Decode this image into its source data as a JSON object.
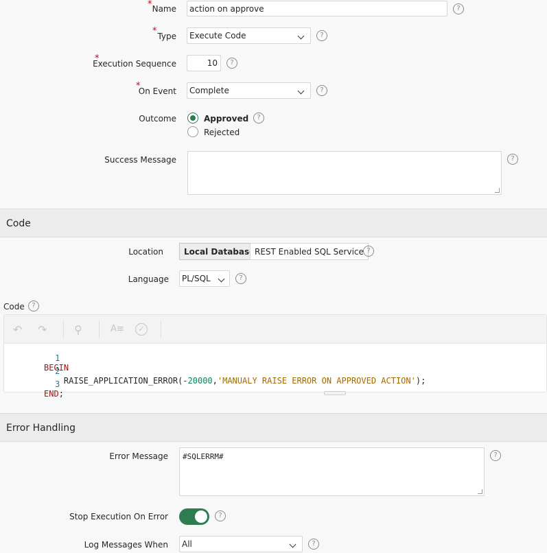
{
  "form": {
    "name_label": "Name",
    "name_value": "action on approve",
    "type_label": "Type",
    "type_value": "Execute Code",
    "exec_seq_label": "Execution Sequence",
    "exec_seq_value": "10",
    "on_event_label": "On Event",
    "on_event_value": "Complete",
    "outcome_label": "Outcome",
    "outcome_options": [
      "Approved",
      "Rejected"
    ],
    "outcome_selected": "Approved",
    "success_label": "Success Message",
    "success_value": ""
  },
  "code_section": {
    "title": "Code",
    "location_label": "Location",
    "location_options": [
      "Local Database",
      "REST Enabled SQL Service"
    ],
    "location_selected": "Local Database",
    "language_label": "Language",
    "language_value": "PL/SQL",
    "code_label": "Code",
    "line_numbers": [
      "1",
      "2",
      "3"
    ],
    "code_tokens": {
      "l1_kw": "BEGIN",
      "l2_fn": "    RAISE_APPLICATION_ERROR(-",
      "l2_num": "20000",
      "l2_comma": ",",
      "l2_str": "'MANUALY RAISE ERROR ON APPROVED ACTION'",
      "l2_end": ");",
      "l3_kw": "END",
      "l3_end": ";"
    }
  },
  "error_section": {
    "title": "Error Handling",
    "error_msg_label": "Error Message",
    "error_msg_value": "#SQLERRM#",
    "stop_label": "Stop Execution On Error",
    "stop_on": true,
    "log_label": "Log Messages When",
    "log_value": "All"
  },
  "icons": {
    "help": "?",
    "required": "*",
    "undo": "↶",
    "redo": "↷",
    "search": "⚲",
    "format": "A≡",
    "validate": "✓"
  },
  "colors": {
    "accent": "#2e7d50",
    "required": "#d0021b"
  }
}
